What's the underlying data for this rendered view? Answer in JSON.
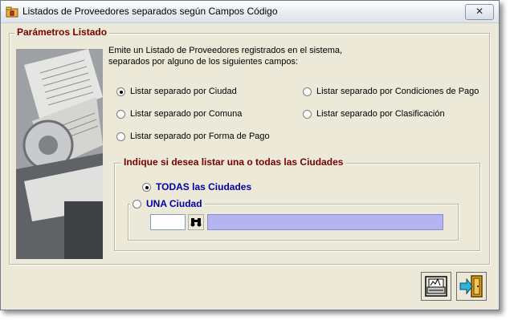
{
  "window": {
    "title": "Listados de Proveedores separados según Campos Código",
    "close_symbol": "✕",
    "app_icon": "folder-lock-icon"
  },
  "params_group": {
    "legend": "Parámetros Listado",
    "description": "Emite un Listado de Proveedores registrados en el sistema, separados por alguno de los siguientes campos:",
    "options": [
      {
        "label": "Listar separado por Ciudad",
        "checked": true
      },
      {
        "label": "Listar separado por Comuna",
        "checked": false
      },
      {
        "label": "Listar separado por Forma de Pago",
        "checked": false
      },
      {
        "label": "Listar separado por Condiciones de Pago",
        "checked": false
      },
      {
        "label": "Listar separado por Clasificación",
        "checked": false
      }
    ]
  },
  "city_group": {
    "legend": "Indique si desea listar una o todas las Ciudades",
    "all_label": "TODAS las Ciudades",
    "one_label": "UNA Ciudad",
    "all_checked": true,
    "code_value": "",
    "name_value": "",
    "search_icon": "binoculars-icon"
  },
  "buttons": {
    "print_icon": "printer-icon",
    "exit_icon": "exit-door-icon"
  },
  "colors": {
    "legend_red": "#7a0000",
    "label_blue": "#0000a8",
    "field_lavender": "#b3b4f1",
    "window_bg": "#ece9d8"
  }
}
